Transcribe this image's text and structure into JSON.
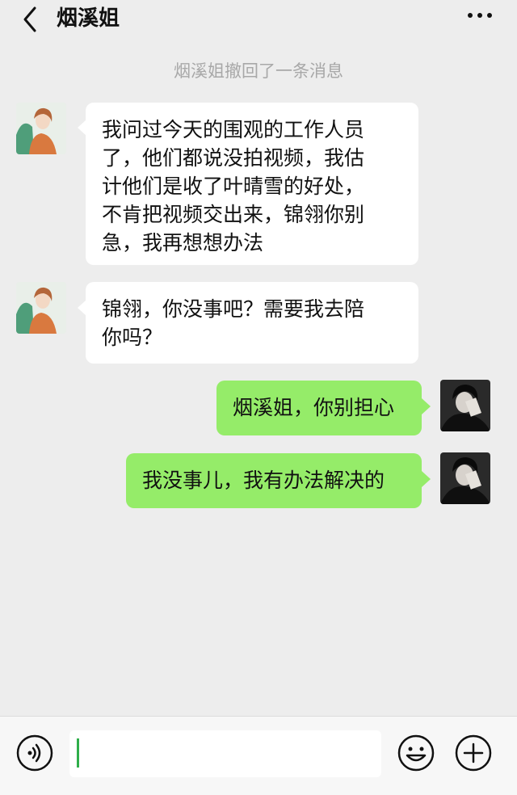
{
  "header": {
    "title": "烟溪姐",
    "back_icon": "chevron-left-icon",
    "more_icon": "more-dots-icon"
  },
  "system_notice": "烟溪姐撤回了一条消息",
  "messages": [
    {
      "side": "left",
      "text_lines": [
        "我问过今天的围观的工作人员",
        "了，他们都说没拍视频，我估",
        "计他们是收了叶晴雪的好处，",
        "不肯把视频交出来，锦翎你别",
        "急，我再想想办法"
      ]
    },
    {
      "side": "left",
      "text_lines": [
        "锦翎，你没事吧？需要我去陪",
        "你吗？"
      ]
    },
    {
      "side": "right",
      "text_lines": [
        "烟溪姐，你别担心"
      ]
    },
    {
      "side": "right",
      "text_lines": [
        "我没事儿，我有办法解决的"
      ]
    }
  ],
  "input": {
    "value": "",
    "voice_icon": "voice-icon",
    "emoji_icon": "emoji-icon",
    "plus_icon": "plus-icon"
  },
  "colors": {
    "background": "#ededed",
    "sent_bubble": "#95ec69",
    "received_bubble": "#ffffff",
    "system_text": "#a8a8a8",
    "cursor": "#2fae4a"
  }
}
